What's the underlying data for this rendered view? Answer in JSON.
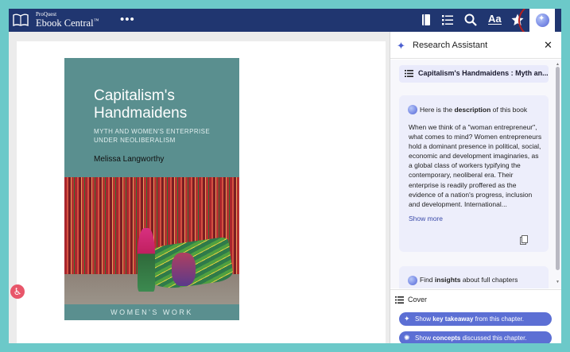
{
  "topbar": {
    "brand_small": "ProQuest",
    "brand_main": "Ebook Central",
    "brand_tm": "™",
    "more": "•••",
    "text_size": "Aa"
  },
  "book": {
    "title": "Capitalism's Handmaidens",
    "subtitle": "MYTH AND WOMEN'S ENTERPRISE UNDER NEOLIBERALISM",
    "author": "Melissa Langworthy",
    "series": "WOMEN'S WORK"
  },
  "panel": {
    "title": "Research Assistant",
    "close": "✕",
    "book_chip": "Capitalism's Handmaidens : Myth an...",
    "description_intro_pre": "Here is the ",
    "description_intro_bold": "description",
    "description_intro_post": " of this book",
    "description_text": "When we think of a \"woman entrepreneur\", what comes to mind? Women entrepreneurs hold a dominant presence in political, social, economic and development imaginaries, as a global class of workers typifying the contemporary, neoliberal era. Their enterprise is readily proffered as the evidence of a nation's progress, inclusion and development. International...",
    "show_more": "Show more",
    "insights_pre": "Find ",
    "insights_bold": "insights",
    "insights_post": " about full chapters",
    "chapter": "Cover",
    "btn1_pre": "Show ",
    "btn1_bold": "key takeaway",
    "btn1_post": " from this chapter.",
    "btn2_pre": "Show ",
    "btn2_bold": "concepts",
    "btn2_post": " discussed this chapter."
  },
  "colors": {
    "topbar": "#203670",
    "accent": "#5c6fd4",
    "background": "#6cc9c9",
    "cover": "#5a8f8f",
    "highlight_ring": "#b51f1f"
  },
  "icons": [
    "book-icon",
    "bookshelf-icon",
    "toc-icon",
    "search-icon",
    "text-size-icon",
    "star-icon",
    "research-assistant-icon",
    "sparkle-icon",
    "close-icon",
    "list-icon",
    "copy-icon",
    "accessibility-icon"
  ]
}
